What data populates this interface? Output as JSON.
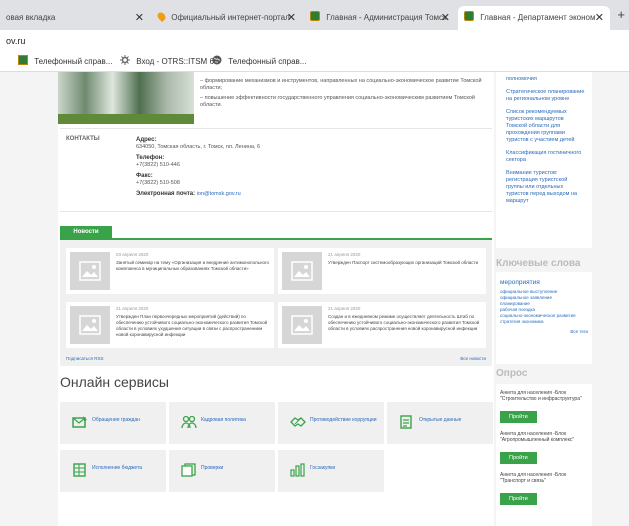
{
  "browser": {
    "tabs": [
      {
        "title": "овая вкладка"
      },
      {
        "title": "Официальный интернет-портал"
      },
      {
        "title": "Главная - Администрация Томск"
      },
      {
        "title": "Главная - Департамент эконом"
      }
    ],
    "new_tab": "+",
    "address": "ov.ru",
    "bookmarks": [
      {
        "label": "Телефонный справ..."
      },
      {
        "label": "Вход - OTRS::ITSM 6"
      },
      {
        "label": "Телефонный справ..."
      }
    ]
  },
  "goals": [
    "– формирование механизмов и инструментов, направленных на социально-экономическое развитие Томской области;",
    "– повышение эффективности государственного управления социально-экономическим развитием Томской области."
  ],
  "contacts": {
    "label": "КОНТАКТЫ",
    "address_label": "Адрес:",
    "address": "634050, Томская область, г. Томск, пл. Ленина, 6",
    "phone_label": "Телефон:",
    "phone": "+7(3822) 510-446",
    "fax_label": "Факс:",
    "fax": "+7(3822) 510-508",
    "email_label": "Электронная почта:",
    "email": "ion@tomsk.gov.ru"
  },
  "news": {
    "tab_label": "Новости",
    "items": [
      {
        "date": "03 апреля 2020",
        "text": "Занятый семинар на тему «Организация и внедрение антимонопольного комплаенса в муниципальных образованиях Томской области»"
      },
      {
        "date": "21 апреля 2020",
        "text": "Утвержден Паспорт системообразующих организаций Томской области"
      },
      {
        "date": "21 апреля 2020",
        "text": "Утвержден План первоочередных мероприятий (действий) по обеспечению устойчивого социально-экономического развития Томской области в условиях ухудшения ситуации в связи с распространением новой коронавирусной инфекции"
      },
      {
        "date": "21 апреля 2020",
        "text": "Создан и в ежедневном режиме осуществляет деятельность Штаб по обеспечению устойчивого социально-экономического развития Томской области в условиях распространения новой коронавирусной инфекции"
      }
    ],
    "subscribe": "Подписаться  RSS",
    "all": "Все новости"
  },
  "online": {
    "title": "Онлайн сервисы",
    "services": [
      {
        "label": "Обращения граждан"
      },
      {
        "label": "Кадровая политика"
      },
      {
        "label": "Противодействие коррупции"
      },
      {
        "label": "Открытые данные"
      },
      {
        "label": "Исполнение бюджета"
      },
      {
        "label": "Проверки"
      },
      {
        "label": "Госзакупки"
      }
    ]
  },
  "sidebar": {
    "links": [
      "полномочия",
      "Стратегическое планирование на региональном уровне",
      "Список рекомендуемых туристских маршрутов Томской области для прохождения группами туристов с участием детей",
      "Классификация гостиничного сектора",
      "Внимание туристов: регистрация туристской группы или отдельных туристов перед выходом на маршрут"
    ],
    "keywords_title": "Ключевые слова",
    "tags": [
      {
        "label": "мероприятия",
        "big": true
      },
      {
        "label": "официальное выступление"
      },
      {
        "label": "официальное заявление"
      },
      {
        "label": "планирование"
      },
      {
        "label": "рабочая поездка"
      },
      {
        "label": "социально-экономическое развитие"
      },
      {
        "label": "стратегия  экономика"
      }
    ],
    "tags_all": "Все теги",
    "poll_title": "Опрос",
    "polls": [
      {
        "question": "Анкета для населения -Блок \"Строительство и инфраструктура\"",
        "button": "Пройти"
      },
      {
        "question": "Анкета для населения -Блок \"Агропромышленный комплекс\"",
        "button": "Пройти"
      },
      {
        "question": "Анкета для населения -Блок \"Транспорт и связь\"",
        "button": "Пройти"
      }
    ]
  }
}
